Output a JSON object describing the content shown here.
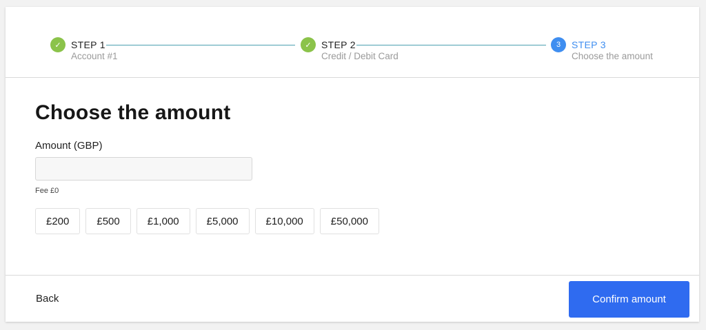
{
  "stepper": {
    "steps": [
      {
        "title": "STEP 1",
        "subtitle": "Account #1",
        "state": "done",
        "marker": "✓"
      },
      {
        "title": "STEP 2",
        "subtitle": "Credit / Debit Card",
        "state": "done",
        "marker": "✓"
      },
      {
        "title": "STEP 3",
        "subtitle": "Choose the amount",
        "state": "active",
        "marker": "3"
      }
    ]
  },
  "main": {
    "title": "Choose the amount",
    "amount_label": "Amount (GBP)",
    "amount_value": "",
    "amount_placeholder": "",
    "fee": "Fee £0",
    "presets": [
      "£200",
      "£500",
      "£1,000",
      "£5,000",
      "£10,000",
      "£50,000"
    ]
  },
  "footer": {
    "back_label": "Back",
    "confirm_label": "Confirm amount"
  },
  "colors": {
    "done": "#8bc34a",
    "active": "#3f8ef0",
    "primary_button": "#2f6bf0"
  }
}
